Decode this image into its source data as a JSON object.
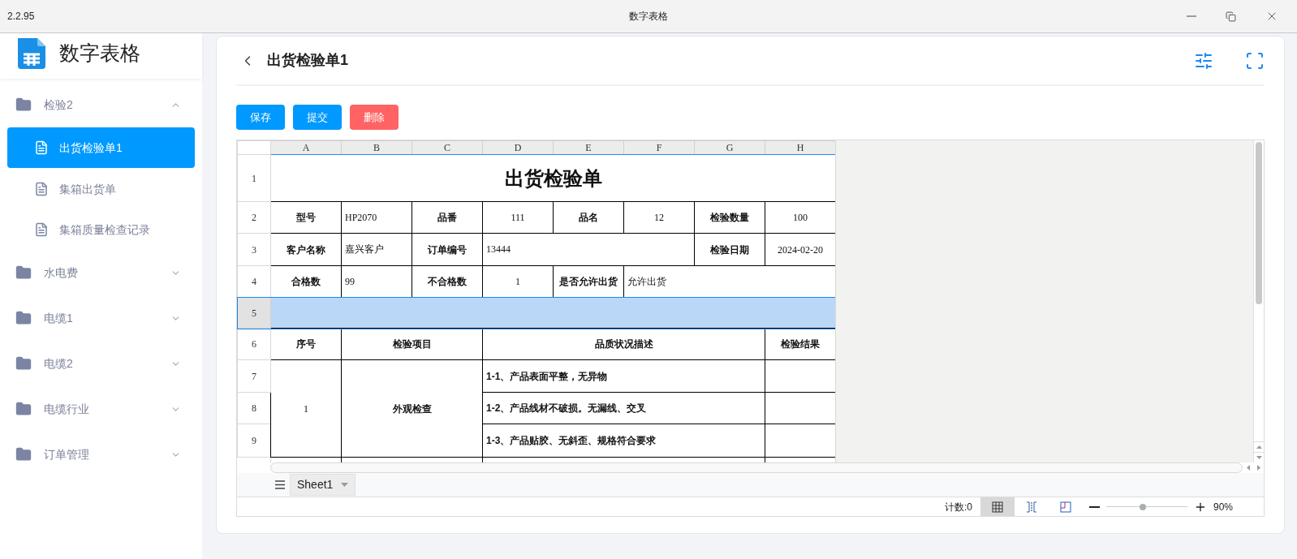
{
  "window": {
    "version": "2.2.95",
    "title": "数字表格"
  },
  "app": {
    "name": "数字表格"
  },
  "sidebar": {
    "groups": [
      {
        "label": "检验2",
        "expanded": true,
        "children": [
          {
            "label": "出货检验单1",
            "selected": true
          },
          {
            "label": "集箱出货单",
            "selected": false
          },
          {
            "label": "集箱质量检查记录",
            "selected": false
          }
        ]
      },
      {
        "label": "水电费",
        "expanded": false
      },
      {
        "label": "电缆1",
        "expanded": false
      },
      {
        "label": "电缆2",
        "expanded": false
      },
      {
        "label": "电缆行业",
        "expanded": false
      },
      {
        "label": "订单管理",
        "expanded": false
      }
    ]
  },
  "page": {
    "title": "出货检验单1"
  },
  "buttons": [
    {
      "label": "保存",
      "kind": "primary"
    },
    {
      "label": "提交",
      "kind": "primary"
    },
    {
      "label": "删除",
      "kind": "danger"
    }
  ],
  "sheet": {
    "columns": [
      "A",
      "B",
      "C",
      "D",
      "E",
      "F",
      "G",
      "H"
    ],
    "rows": [
      {
        "header": "1",
        "selected": false,
        "cells": [
          {
            "kind": "title",
            "text": "出货检验单",
            "colspan": 8
          }
        ]
      },
      {
        "header": "2",
        "selected": false,
        "cells": [
          {
            "kind": "label",
            "text": "型号"
          },
          {
            "kind": "value",
            "text": "HP2070"
          },
          {
            "kind": "label",
            "text": "品番"
          },
          {
            "kind": "number",
            "text": "111"
          },
          {
            "kind": "label",
            "text": "品名"
          },
          {
            "kind": "number",
            "text": "12"
          },
          {
            "kind": "label",
            "text": "检验数量"
          },
          {
            "kind": "number",
            "text": "100"
          }
        ]
      },
      {
        "header": "3",
        "selected": false,
        "cells": [
          {
            "kind": "label",
            "text": "客户名称"
          },
          {
            "kind": "value",
            "text": "嘉兴客户"
          },
          {
            "kind": "label",
            "text": "订单编号"
          },
          {
            "kind": "value",
            "text": "13444",
            "colspan": 3
          },
          {
            "kind": "label",
            "text": "检验日期"
          },
          {
            "kind": "number",
            "text": "2024-02-20"
          }
        ]
      },
      {
        "header": "4",
        "selected": false,
        "cells": [
          {
            "kind": "label",
            "text": "合格数"
          },
          {
            "kind": "value",
            "text": "99"
          },
          {
            "kind": "label",
            "text": "不合格数"
          },
          {
            "kind": "number",
            "text": "1"
          },
          {
            "kind": "label",
            "text": "是否允许出货"
          },
          {
            "kind": "value",
            "text": "允许出货",
            "colspan": 3
          }
        ]
      },
      {
        "header": "5",
        "selected": true,
        "cells": [
          {
            "kind": "blank",
            "colspan": 8
          }
        ]
      },
      {
        "header": "6",
        "selected": false,
        "cells": [
          {
            "kind": "label",
            "text": "序号"
          },
          {
            "kind": "label",
            "text": "检验项目",
            "colspan": 2
          },
          {
            "kind": "label",
            "text": "品质状况描述",
            "colspan": 4
          },
          {
            "kind": "label",
            "text": "检验结果"
          }
        ]
      },
      {
        "header": "7",
        "selected": false,
        "cells": [
          {
            "kind": "number",
            "text": "1",
            "rowspan": 3
          },
          {
            "kind": "label",
            "text": "外观检查",
            "colspan": 2,
            "rowspan": 3
          },
          {
            "kind": "item",
            "text": "1-1、产品表面平整，无异物",
            "colspan": 4
          },
          {
            "kind": "blank"
          }
        ]
      },
      {
        "header": "8",
        "selected": false,
        "cells": [
          {
            "kind": "item",
            "text": "1-2、产品线材不破损。无漏线、交叉",
            "colspan": 4
          },
          {
            "kind": "blank"
          }
        ]
      },
      {
        "header": "9",
        "selected": false,
        "cells": [
          {
            "kind": "item",
            "text": "1-3、产品贴胶、无斜歪、规格符合要求",
            "colspan": 4
          },
          {
            "kind": "blank"
          }
        ]
      }
    ],
    "tab": "Sheet1"
  },
  "status_bar": {
    "count": "计数:0",
    "views": [
      {
        "kind": "normal",
        "selected": true
      },
      {
        "kind": "page-break",
        "selected": false
      },
      {
        "kind": "page-layout",
        "selected": false
      }
    ],
    "zoom": {
      "level": 0.45,
      "reading": "90%"
    }
  }
}
